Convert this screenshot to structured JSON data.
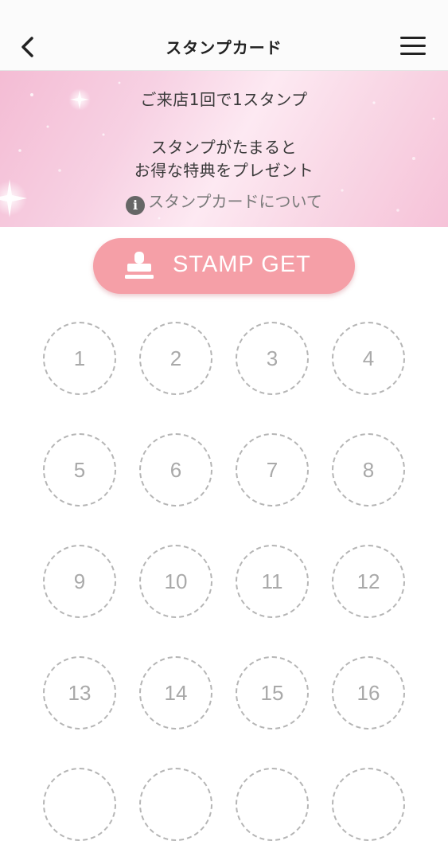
{
  "header": {
    "title": "スタンプカード",
    "back_icon": "chevron-left-icon",
    "menu_icon": "hamburger-menu-icon"
  },
  "banner": {
    "line1": "ご来店1回で1スタンプ",
    "line2": "スタンプがたまると",
    "line3": "お得な特典をプレゼント",
    "info_link": "スタンプカードについて",
    "info_icon_glyph": "i"
  },
  "stamp_button": {
    "label": "STAMP GET",
    "color": "#f59fa7",
    "icon": "stamp-icon"
  },
  "stamps": {
    "total_visible": 16,
    "collected": 0,
    "slots": [
      "1",
      "2",
      "3",
      "4",
      "5",
      "6",
      "7",
      "8",
      "9",
      "10",
      "11",
      "12",
      "13",
      "14",
      "15",
      "16"
    ]
  },
  "colors": {
    "banner_pink": "#f7c9dc",
    "slot_border": "#b5b5b5",
    "slot_text": "#a9a9a9"
  }
}
